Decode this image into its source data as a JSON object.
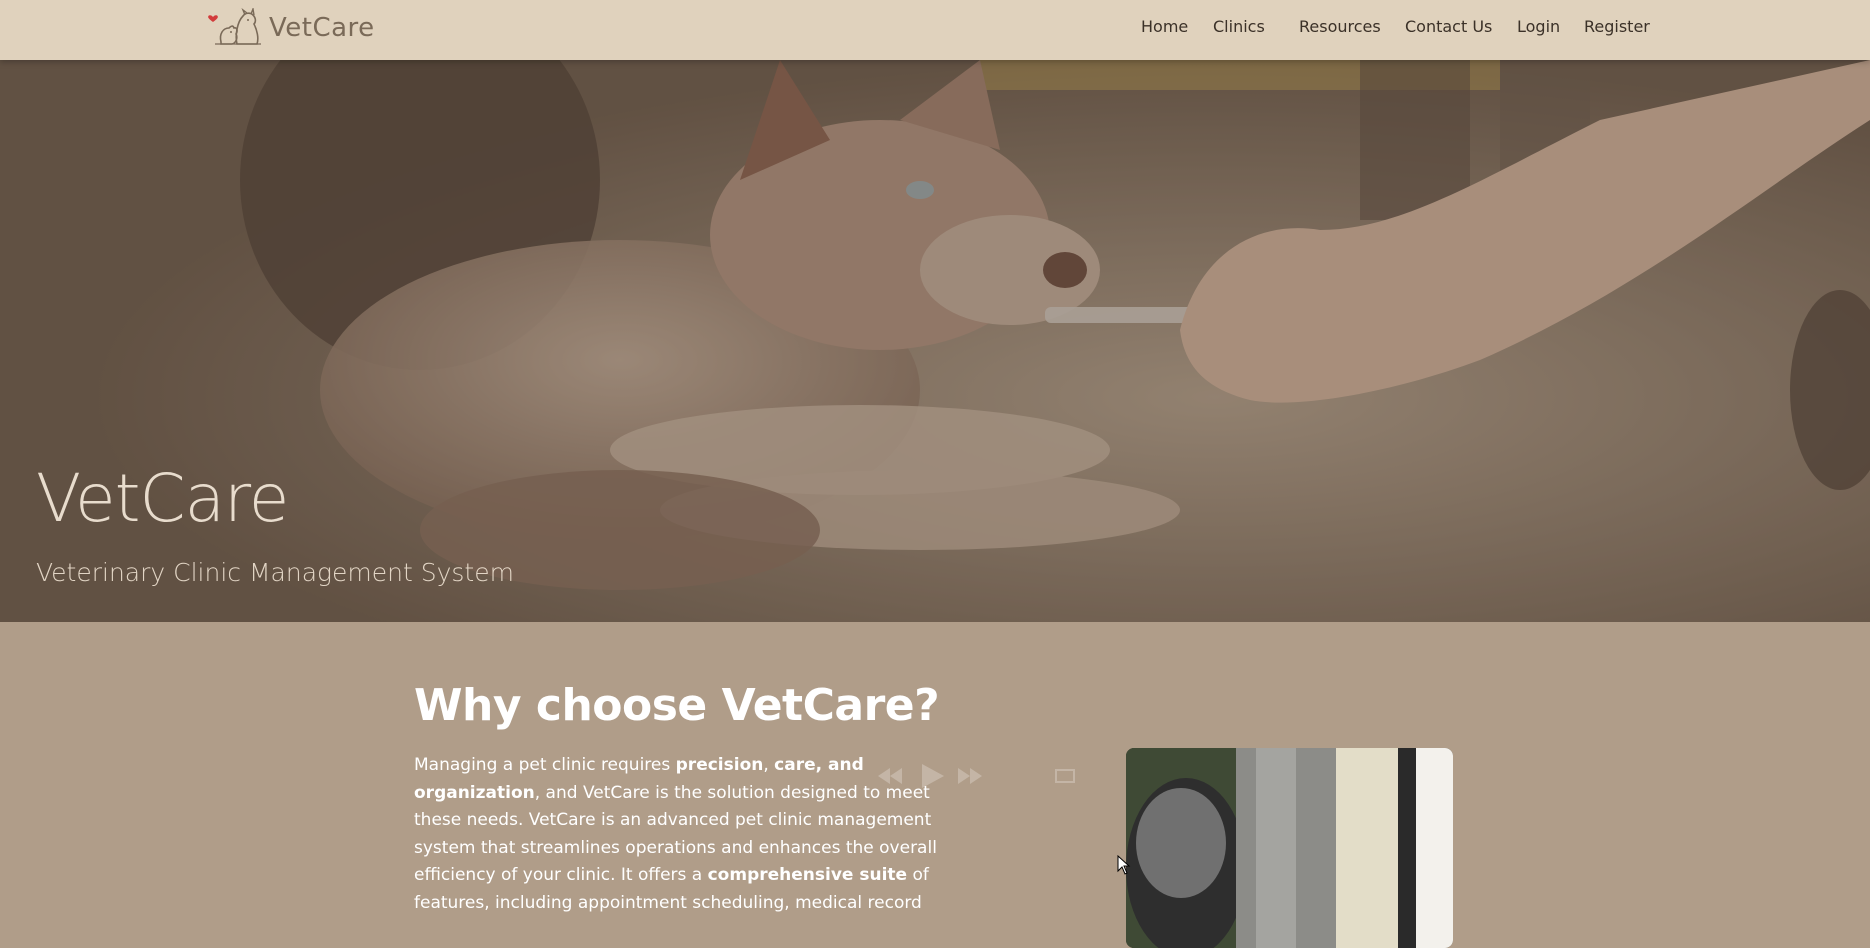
{
  "header": {
    "brand_name": "VetCare",
    "logo_icon": "pets-heart-logo-icon",
    "nav": [
      {
        "label": "Home"
      },
      {
        "label": "Clinics"
      },
      {
        "label": "Resources"
      },
      {
        "label": "Contact Us"
      },
      {
        "label": "Login"
      },
      {
        "label": "Register"
      }
    ]
  },
  "hero": {
    "title": "VetCare",
    "subtitle": "Veterinary Clinic Management System"
  },
  "why": {
    "title": "Why choose VetCare?",
    "paragraph": [
      {
        "text": "Managing a pet clinic requires ",
        "bold": false
      },
      {
        "text": "precision",
        "bold": true
      },
      {
        "text": ", ",
        "bold": false
      },
      {
        "text": "care, and organization",
        "bold": true
      },
      {
        "text": ", and VetCare is the solution designed to meet these needs. VetCare is an advanced pet clinic management system that streamlines operations and enhances the overall efficiency of your clinic. It offers a ",
        "bold": false
      },
      {
        "text": "comprehensive suite",
        "bold": true
      },
      {
        "text": " of features, including appointment scheduling, medical record",
        "bold": false
      }
    ]
  },
  "colors": {
    "header_bg": "#e0d2bd",
    "content_bg": "#b09d89",
    "text_on_content": "#ffffff",
    "nav_text": "#3b3128",
    "brand_text": "#7a6a58",
    "logo_heart": "#d23b3b"
  },
  "icons": {
    "video_rewind": "rewind-icon",
    "video_play": "play-icon",
    "video_forward": "fast-forward-icon",
    "cursor": "mouse-cursor-icon"
  }
}
